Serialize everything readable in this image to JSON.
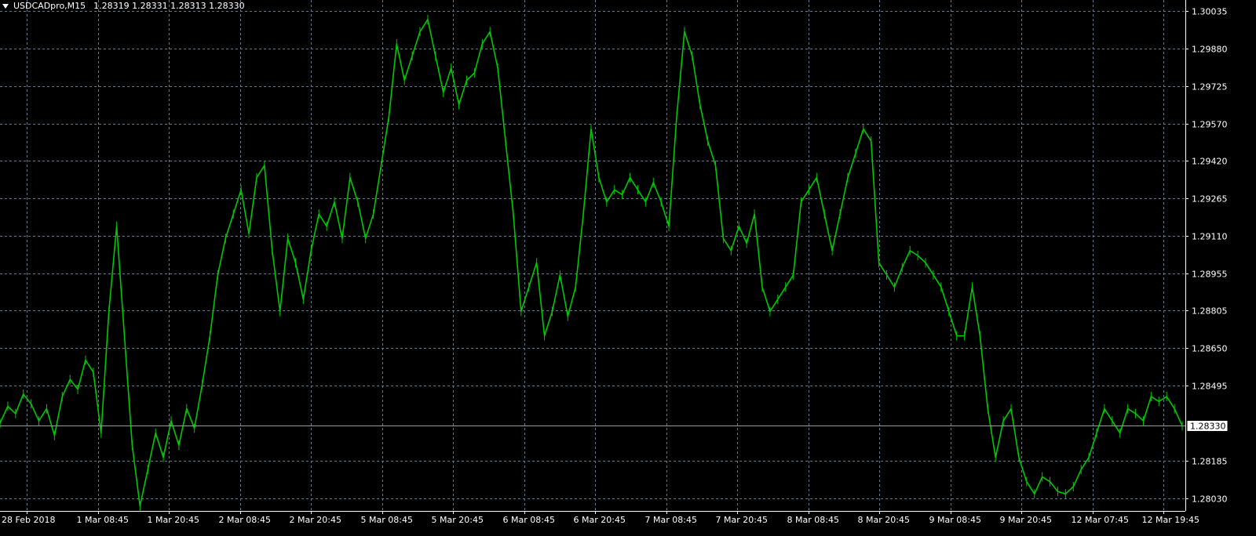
{
  "header": {
    "symbol": "USDCADpro,M15",
    "ohlc": "1.28319 1.28331 1.28313 1.28330"
  },
  "colors": {
    "background": "#000000",
    "grid": "#64788c",
    "axis": "#ffffff",
    "series": "#00c800",
    "current_price_line": "#9a9a9a"
  },
  "chart_data": {
    "type": "line",
    "symbol": "USDCADpro",
    "timeframe": "M15",
    "grid": true,
    "y_ticks": [
      "1.30035",
      "1.29880",
      "1.29725",
      "1.29570",
      "1.29420",
      "1.29265",
      "1.29110",
      "1.28955",
      "1.28805",
      "1.28650",
      "1.28495",
      "1.28185",
      "1.28030"
    ],
    "y_tick_values": [
      1.30035,
      1.2988,
      1.29725,
      1.2957,
      1.2942,
      1.29265,
      1.2911,
      1.28955,
      1.28805,
      1.2865,
      1.28495,
      1.28185,
      1.2803
    ],
    "current_price": "1.28330",
    "current_price_value": 1.2833,
    "x_ticks": [
      "28 Feb 2018",
      "1 Mar 08:45",
      "1 Mar 20:45",
      "2 Mar 08:45",
      "2 Mar 20:45",
      "5 Mar 08:45",
      "5 Mar 20:45",
      "6 Mar 08:45",
      "6 Mar 20:45",
      "7 Mar 08:45",
      "7 Mar 20:45",
      "8 Mar 08:45",
      "8 Mar 20:45",
      "9 Mar 08:45",
      "9 Mar 20:45",
      "12 Mar 07:45",
      "12 Mar 19:45"
    ],
    "ylim": [
      1.2798,
      1.3008
    ],
    "series": [
      {
        "values": [
          1.2834,
          1.2841,
          1.2838,
          1.2846,
          1.2842,
          1.2835,
          1.284,
          1.2829,
          1.2845,
          1.2852,
          1.2848,
          1.286,
          1.2855,
          1.283,
          1.288,
          1.2915,
          1.287,
          1.2825,
          1.28,
          1.2815,
          1.283,
          1.282,
          1.2835,
          1.2825,
          1.284,
          1.2832,
          1.285,
          1.287,
          1.2895,
          1.291,
          1.292,
          1.293,
          1.2912,
          1.2935,
          1.294,
          1.2905,
          1.288,
          1.291,
          1.29,
          1.2885,
          1.2905,
          1.292,
          1.2915,
          1.2925,
          1.291,
          1.2935,
          1.2925,
          1.291,
          1.292,
          1.294,
          1.296,
          1.299,
          1.2975,
          1.2985,
          1.2995,
          1.3,
          1.2985,
          1.297,
          1.298,
          1.2965,
          1.2975,
          1.2978,
          1.299,
          1.2995,
          1.298,
          1.295,
          1.292,
          1.288,
          1.289,
          1.29,
          1.287,
          1.288,
          1.2895,
          1.2878,
          1.289,
          1.292,
          1.2955,
          1.2935,
          1.2925,
          1.293,
          1.2928,
          1.2935,
          1.293,
          1.2925,
          1.2933,
          1.2925,
          1.2915,
          1.296,
          1.2995,
          1.2985,
          1.2965,
          1.295,
          1.294,
          1.291,
          1.2905,
          1.2915,
          1.2908,
          1.292,
          1.289,
          1.288,
          1.2885,
          1.289,
          1.2895,
          1.2925,
          1.293,
          1.2935,
          1.292,
          1.2905,
          1.292,
          1.2935,
          1.2945,
          1.2955,
          1.295,
          1.29,
          1.2895,
          1.289,
          1.2898,
          1.2905,
          1.2903,
          1.29,
          1.2895,
          1.289,
          1.288,
          1.287,
          1.287,
          1.289,
          1.287,
          1.284,
          1.282,
          1.2835,
          1.284,
          1.282,
          1.281,
          1.2805,
          1.2812,
          1.281,
          1.2806,
          1.2805,
          1.2808,
          1.2815,
          1.282,
          1.283,
          1.284,
          1.2835,
          1.283,
          1.284,
          1.2838,
          1.2835,
          1.2845,
          1.2843,
          1.2845,
          1.284,
          1.2833
        ]
      }
    ]
  }
}
